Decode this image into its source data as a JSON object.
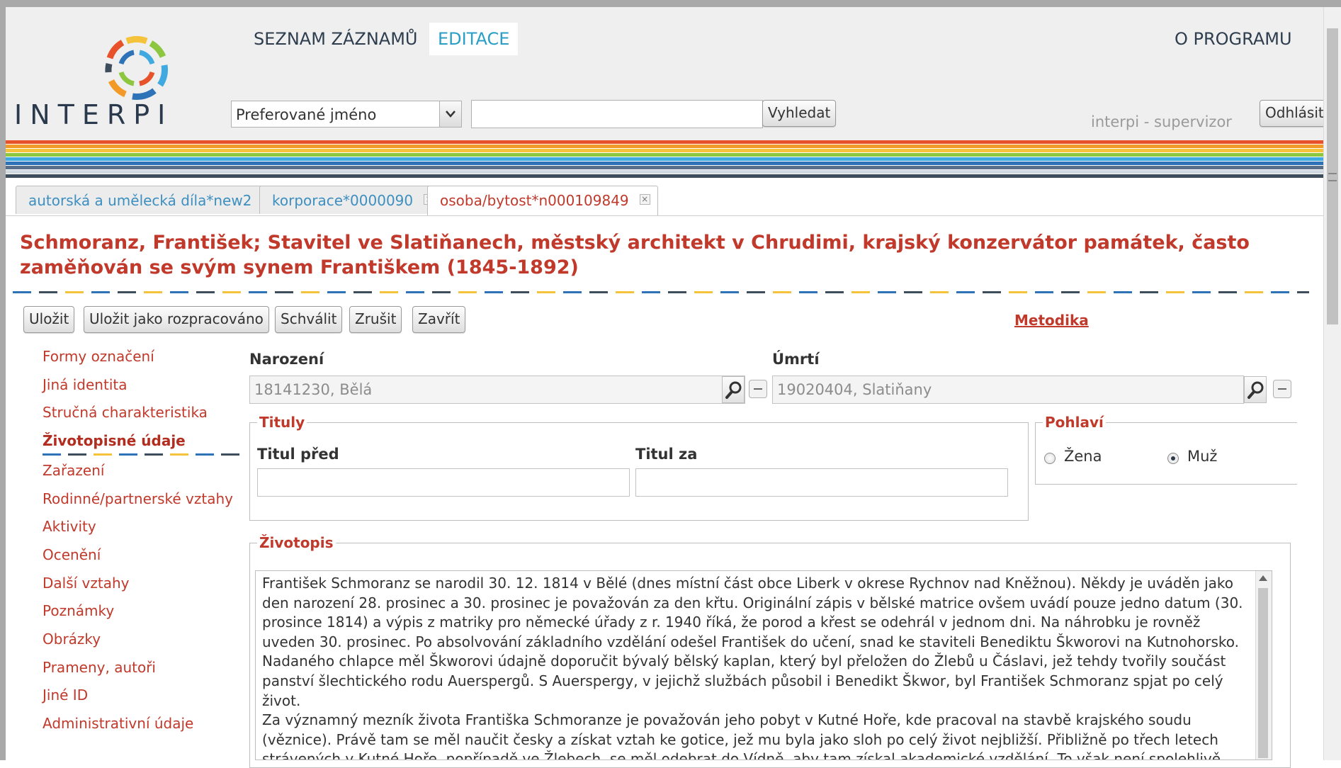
{
  "app": {
    "logo_text": "INTERPI"
  },
  "nav": {
    "items": [
      "SEZNAM ZÁZNAMŮ",
      "EDITACE"
    ],
    "about": "O PROGRAMU",
    "active_index": 1
  },
  "search": {
    "type_selected": "Preferované jméno",
    "value": "",
    "button": "Vyhledat"
  },
  "user": {
    "label": "interpi - supervizor",
    "logout": "Odhlásit"
  },
  "stripe_colors": [
    "#e8522a",
    "#f29a27",
    "#f5c33b",
    "#8dc63f",
    "#3fa9e0",
    "#2e73b8",
    "#5a6f8a",
    "#d1d9e0",
    "#3d4d5c"
  ],
  "tabs": [
    {
      "label": "autorská a umělecká díla*new2",
      "active": false
    },
    {
      "label": "korporace*0000090",
      "active": false
    },
    {
      "label": "osoba/bytost*n000109849",
      "active": true
    }
  ],
  "record": {
    "title": "Schmoranz, František; Stavitel ve Slatiňanech, městský architekt v Chrudimi, krajský konzervátor památek, často zaměňován se svým synem Františkem (1845-1892)"
  },
  "toolbar": {
    "save": "Uložit",
    "save_draft": "Uložit jako rozpracováno",
    "approve": "Schválit",
    "cancel": "Zrušit",
    "close": "Zavřít",
    "metodika": "Metodika"
  },
  "sidebar": {
    "items": [
      "Formy označení",
      "Jiná identita",
      "Stručná charakteristika",
      "Životopisné údaje",
      "Zařazení",
      "Rodinné/partnerské vztahy",
      "Aktivity",
      "Ocenění",
      "Další vztahy",
      "Poznámky",
      "Obrázky",
      "Prameny, autoři",
      "Jiné ID",
      "Administrativní údaje"
    ],
    "active_index": 3
  },
  "form": {
    "birth": {
      "label": "Narození",
      "value": "18141230, Bělá"
    },
    "death": {
      "label": "Úmrtí",
      "value": "19020404, Slatiňany"
    },
    "titles": {
      "legend": "Tituly",
      "before_label": "Titul před",
      "after_label": "Titul za",
      "before_value": "",
      "after_value": ""
    },
    "gender": {
      "legend": "Pohlaví",
      "options": [
        "Žena",
        "Muž"
      ],
      "selected": "Muž"
    },
    "bio": {
      "legend": "Životopis",
      "paragraphs": [
        "František Schmoranz se narodil 30. 12. 1814 v Bělé (dnes místní část obce Liberk v okrese Rychnov nad Kněžnou). Někdy je uváděn jako den narození 28. prosinec a 30. prosinec je považován za den křtu. Originální zápis v bělské matrice ovšem uvádí pouze jedno datum (30. prosince 1814) a výpis z matriky pro německé úřady z r. 1940 říká, že porod a křest se odehrál v jednom dni. Na náhrobku je rovněž uveden 30. prosinec. Po absolvování základního vzdělání odešel František do učení, snad ke staviteli Benediktu Škworovi na Kutnohorsko. Nadaného chlapce měl Škworovi údajně doporučit bývalý bělský kaplan, který byl přeložen do Žlebů u Čáslavi, jež tehdy tvořily součást panství šlechtického rodu Auerspergů. S Auerspergy, v jejichž službách působil i Benedikt Škwor, byl František Schmoranz spjat po celý život.",
        "Za významný mezník života Františka Schmoranze je považován jeho pobyt v Kutné Hoře, kde pracoval na stavbě krajského soudu (věznice). Právě tam se měl naučit česky a získat vztah ke gotice, jež mu byla jako sloh po celý život nejbližší. Přibližně po třech letech strávených v Kutné Hoře, popřípadě ve Žlebech, se měl odebrat do Vídně, aby tam získal akademické vzdělání. To však není spolehlivě doloženo."
      ]
    }
  }
}
